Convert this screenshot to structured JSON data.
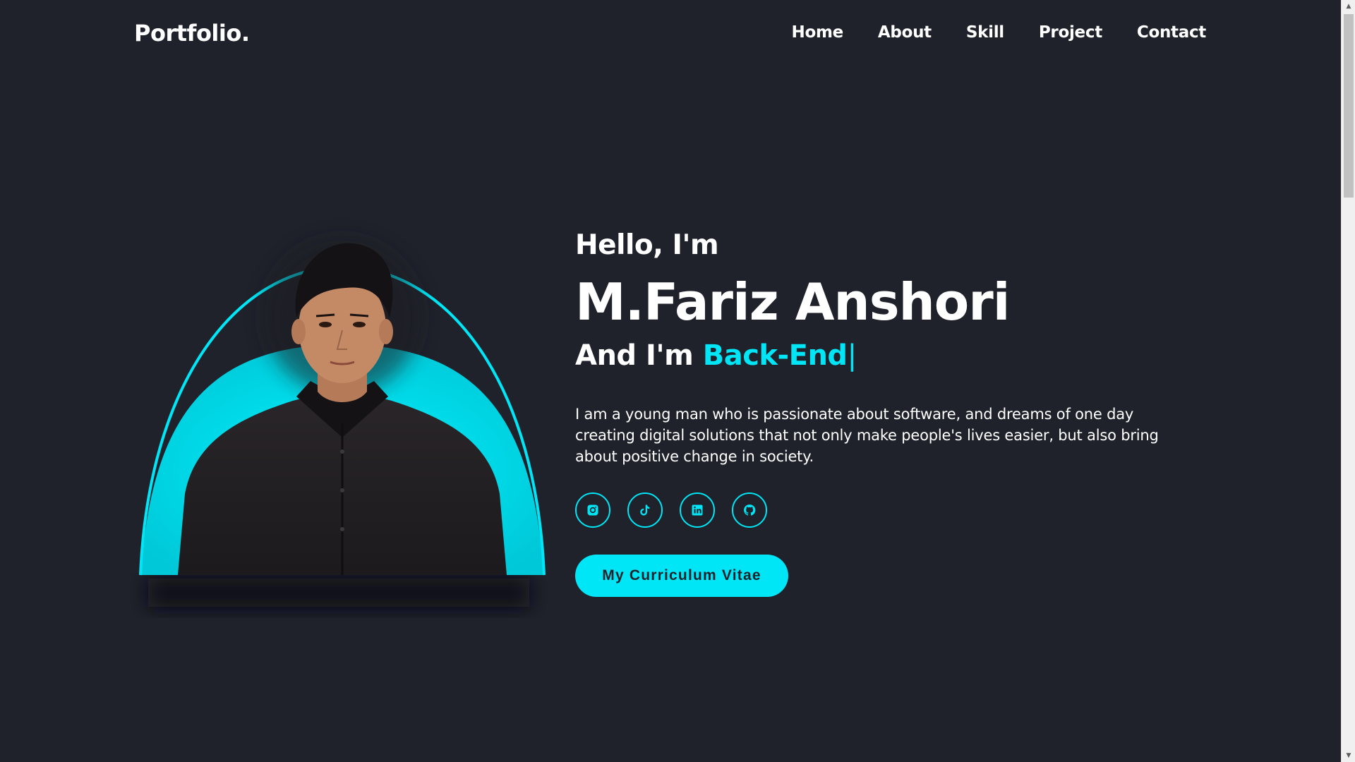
{
  "header": {
    "logo": "Portfolio.",
    "nav": [
      "Home",
      "About",
      "Skill",
      "Project",
      "Contact"
    ]
  },
  "hero": {
    "greeting": "Hello, I'm",
    "name": "M.Fariz Anshori",
    "role_prefix": "And I'm ",
    "role_highlight": "Back-End",
    "cursor": "|",
    "description": "I am a young man who is passionate about software, and dreams of one day creating digital solutions that not only make people's lives easier, but also bring about positive change in society.",
    "socials": [
      "instagram-icon",
      "tiktok-icon",
      "linkedin-icon",
      "github-icon"
    ],
    "cv_button": "My Curriculum Vitae"
  },
  "colors": {
    "background": "#1f222b",
    "accent": "#00e6f6",
    "text": "#ffffff"
  }
}
